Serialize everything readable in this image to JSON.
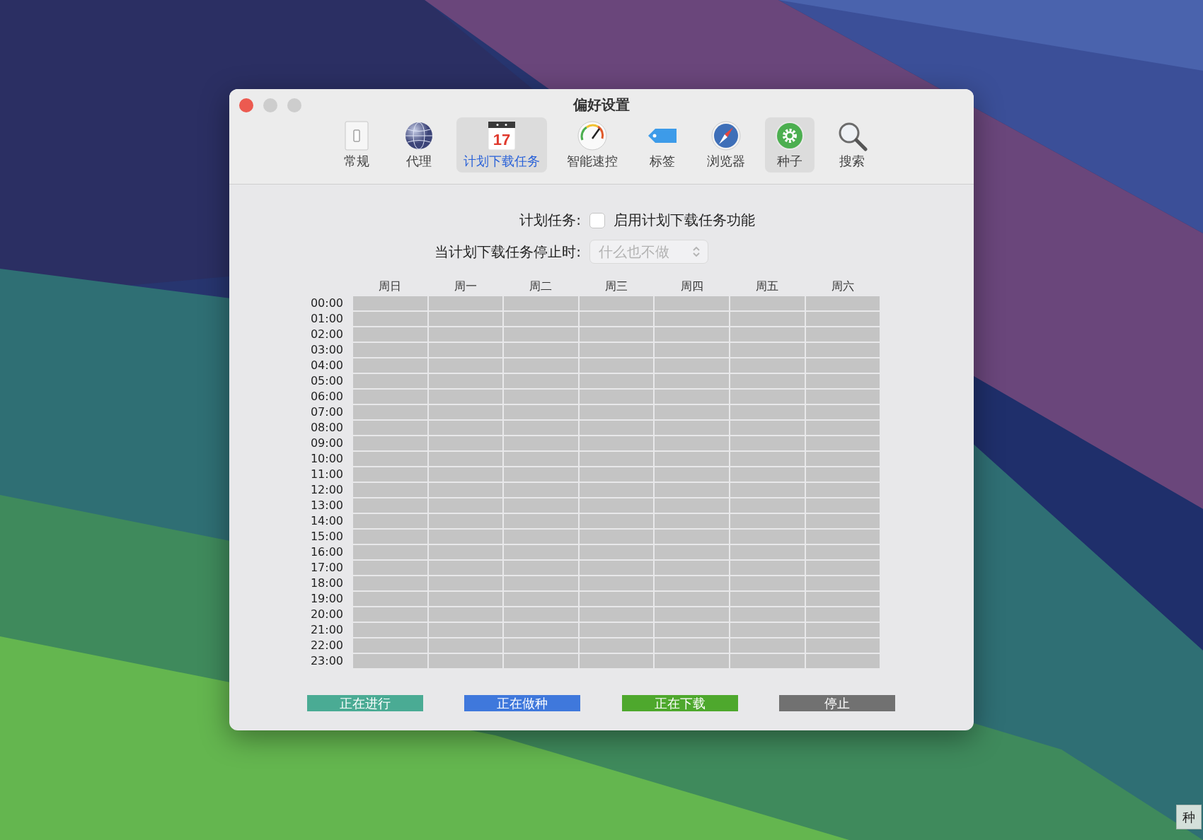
{
  "window": {
    "title": "偏好设置"
  },
  "toolbar": [
    {
      "kind": "switch",
      "label": "常规",
      "selected": false,
      "hovered": false
    },
    {
      "kind": "globe",
      "label": "代理",
      "selected": false,
      "hovered": false
    },
    {
      "kind": "calendar",
      "label": "计划下载任务",
      "calendar_day": "17",
      "selected": true,
      "hovered": false
    },
    {
      "kind": "gauge",
      "label": "智能速控",
      "selected": false,
      "hovered": false
    },
    {
      "kind": "tag",
      "label": "标签",
      "selected": false,
      "hovered": false
    },
    {
      "kind": "compass",
      "label": "浏览器",
      "selected": false,
      "hovered": false
    },
    {
      "kind": "gear",
      "label": "种子",
      "selected": false,
      "hovered": true
    },
    {
      "kind": "magnifier",
      "label": "搜索",
      "selected": false,
      "hovered": false
    }
  ],
  "schedule_toggle": {
    "label": "计划任务:",
    "checkbox_label": "启用计划下载任务功能",
    "checked": false
  },
  "on_stop": {
    "label": "当计划下载任务停止时:",
    "value": "什么也不做",
    "disabled": true
  },
  "grid": {
    "days": [
      "周日",
      "周一",
      "周二",
      "周三",
      "周四",
      "周五",
      "周六"
    ],
    "hours": [
      "00:00",
      "01:00",
      "02:00",
      "03:00",
      "04:00",
      "05:00",
      "06:00",
      "07:00",
      "08:00",
      "09:00",
      "10:00",
      "11:00",
      "12:00",
      "13:00",
      "14:00",
      "15:00",
      "16:00",
      "17:00",
      "18:00",
      "19:00",
      "20:00",
      "21:00",
      "22:00",
      "23:00"
    ]
  },
  "legend": [
    {
      "label": "正在进行",
      "color": "#4aab94"
    },
    {
      "label": "正在做种",
      "color": "#3f78dc"
    },
    {
      "label": "正在下载",
      "color": "#4ea82d"
    },
    {
      "label": "停止",
      "color": "#717171"
    }
  ],
  "tooltip": {
    "text": "种"
  }
}
